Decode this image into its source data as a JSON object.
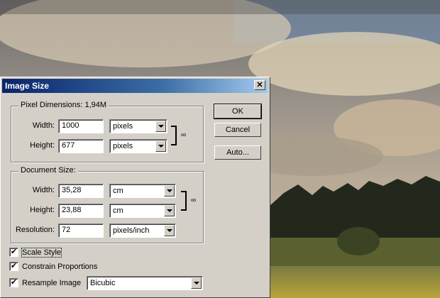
{
  "dialog": {
    "title": "Image Size",
    "close_label": "✕",
    "pixel_dimensions": {
      "legend": "Pixel Dimensions:  1,94M",
      "width_label": "Width:",
      "width_value": "1000",
      "width_unit": "pixels",
      "height_label": "Height:",
      "height_value": "677",
      "height_unit": "pixels"
    },
    "document_size": {
      "legend": "Document Size:",
      "width_label": "Width:",
      "width_value": "35,28",
      "width_unit": "cm",
      "height_label": "Height:",
      "height_value": "23,88",
      "height_unit": "cm",
      "resolution_label": "Resolution:",
      "resolution_value": "72",
      "resolution_unit": "pixels/inch"
    },
    "buttons": {
      "ok": "OK",
      "cancel": "Cancel",
      "auto": "Auto..."
    },
    "options": {
      "scale_style": "Scale Style",
      "constrain": "Constrain Proportions",
      "resample": "Resample Image",
      "resample_method": "Bicubic",
      "check_mark": "✔"
    }
  }
}
